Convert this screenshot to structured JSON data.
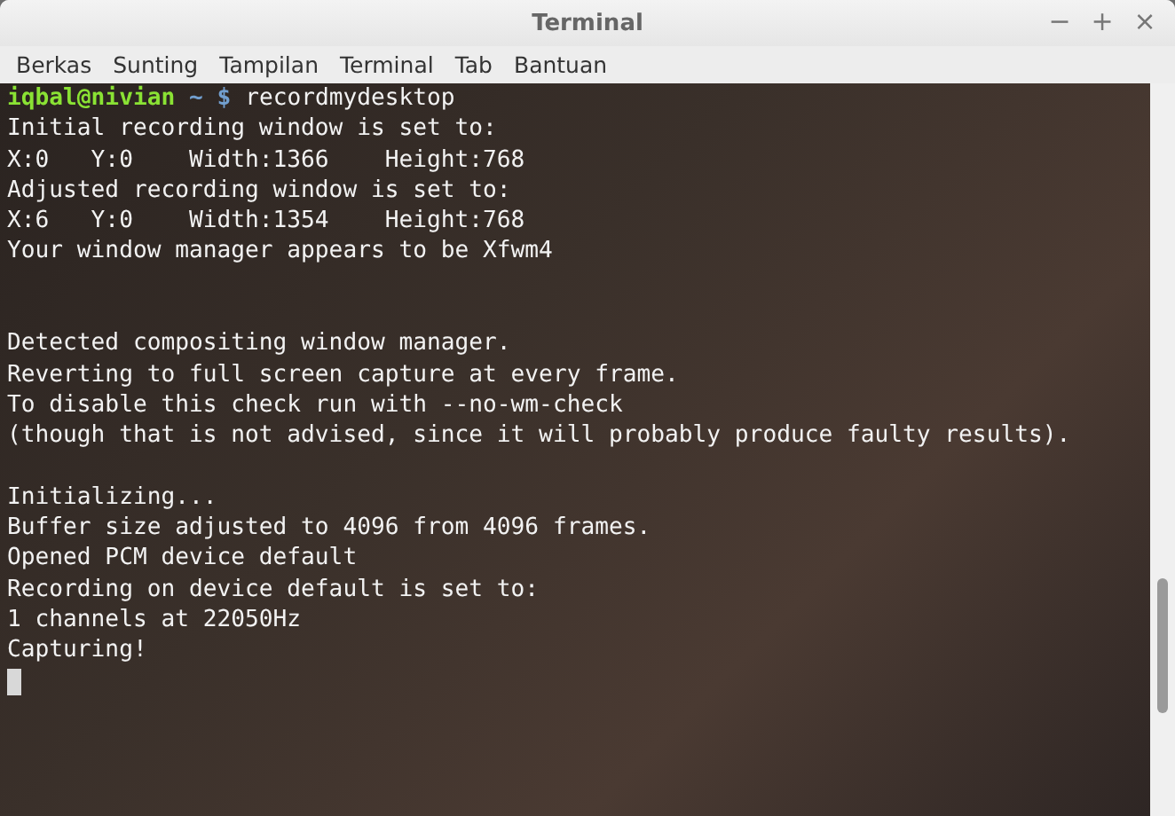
{
  "window": {
    "title": "Terminal",
    "controls": [
      "−",
      "+",
      "×"
    ]
  },
  "menu": [
    "Berkas",
    "Sunting",
    "Tampilan",
    "Terminal",
    "Tab",
    "Bantuan"
  ],
  "terminal": {
    "prompt": {
      "user": "iqbal@nivian",
      "path": "~",
      "symbol": "$",
      "command": "recordmydesktop"
    },
    "lines": [
      {
        "kind": "text",
        "text": "Initial recording window is set to:"
      },
      {
        "kind": "text",
        "text": "X:0   Y:0    Width:1366    Height:768"
      },
      {
        "kind": "text",
        "text": "Adjusted recording window is set to:"
      },
      {
        "kind": "text",
        "text": "X:6   Y:0    Width:1354    Height:768"
      },
      {
        "kind": "text",
        "text": "Your window manager appears to be Xfwm4"
      },
      {
        "kind": "blank"
      },
      {
        "kind": "blank"
      },
      {
        "kind": "text",
        "text": "Detected compositing window manager."
      },
      {
        "kind": "text",
        "text": "Reverting to full screen capture at every frame."
      },
      {
        "kind": "text",
        "text": "To disable this check run with --no-wm-check"
      },
      {
        "kind": "text",
        "text": "(though that is not advised, since it will probably produce faulty results)."
      },
      {
        "kind": "blank"
      },
      {
        "kind": "text",
        "text": "Initializing..."
      },
      {
        "kind": "text",
        "text": "Buffer size adjusted to 4096 from 4096 frames."
      },
      {
        "kind": "text",
        "text": "Opened PCM device default"
      },
      {
        "kind": "text",
        "text": "Recording on device default is set to:"
      },
      {
        "kind": "text",
        "text": "1 channels at 22050Hz"
      },
      {
        "kind": "text",
        "text": "Capturing!"
      }
    ]
  }
}
